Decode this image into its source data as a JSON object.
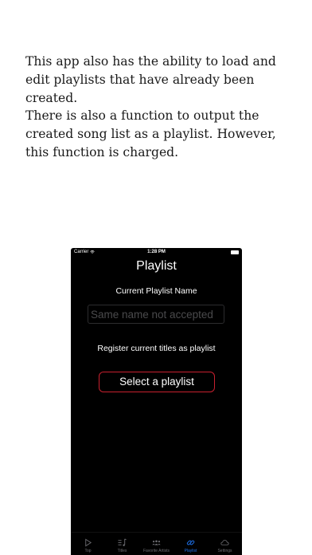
{
  "description": {
    "paragraph1": "This app also has the ability to load and edit playlists that have already been created.",
    "paragraph2": "There is also a function to output the created song list as a playlist. However, this function is charged."
  },
  "statusbar": {
    "carrier": "Carrier",
    "time": "1:28 PM"
  },
  "screen": {
    "title": "Playlist",
    "current_name_label": "Current Playlist Name",
    "name_placeholder": "Same name not accepted",
    "register_label": "Register current titles as playlist",
    "select_button": "Select a playlist"
  },
  "tabs": [
    {
      "label": "Top",
      "icon": "play-icon",
      "active": false
    },
    {
      "label": "Titles",
      "icon": "music-list-icon",
      "active": false
    },
    {
      "label": "Favorite Artists",
      "icon": "people-icon",
      "active": false
    },
    {
      "label": "Playlist",
      "icon": "link-icon",
      "active": true
    },
    {
      "label": "Settings",
      "icon": "cloud-icon",
      "active": false
    }
  ],
  "colors": {
    "accent": "#1d6fe6",
    "button_border": "#c8202f",
    "inactive": "#6d6d72"
  }
}
